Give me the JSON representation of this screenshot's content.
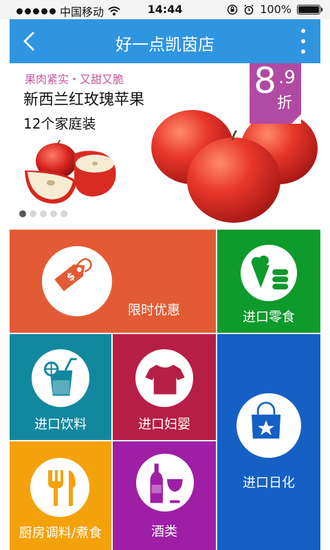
{
  "status_bar": {
    "carrier": "中国移动",
    "time": "14:44",
    "battery": "100%"
  },
  "nav": {
    "title": "好一点凯茵店",
    "back_icon": "chevron-left-icon",
    "more_icon": "more-vertical-icon"
  },
  "banner": {
    "tagline": "果肉紧实・又甜又脆",
    "product": "新西兰红玫瑰苹果",
    "pack": "12个家庭装",
    "discount_major": "8",
    "discount_minor": ".9",
    "discount_unit": "折",
    "pager_count": 5,
    "pager_active": 1
  },
  "tiles": {
    "flash_sale": {
      "label": "限时优惠",
      "icon": "price-tag-icon",
      "color": "#e35b34"
    },
    "snacks": {
      "label": "进口零食",
      "icon": "snack-icon",
      "color": "#0f9a2c"
    },
    "drinks": {
      "label": "进口饮料",
      "icon": "drink-icon",
      "color": "#12889e"
    },
    "baby": {
      "label": "进口妇婴",
      "icon": "tshirt-icon",
      "color": "#b61e45"
    },
    "daily": {
      "label": "进口日化",
      "icon": "shopping-bag-icon",
      "color": "#1560c4"
    },
    "kitchen": {
      "label": "厨房调料/煮食",
      "icon": "fork-knife-icon",
      "color": "#f4a20c"
    },
    "wine": {
      "label": "酒类",
      "icon": "wine-icon",
      "color": "#9e1fa6"
    }
  }
}
